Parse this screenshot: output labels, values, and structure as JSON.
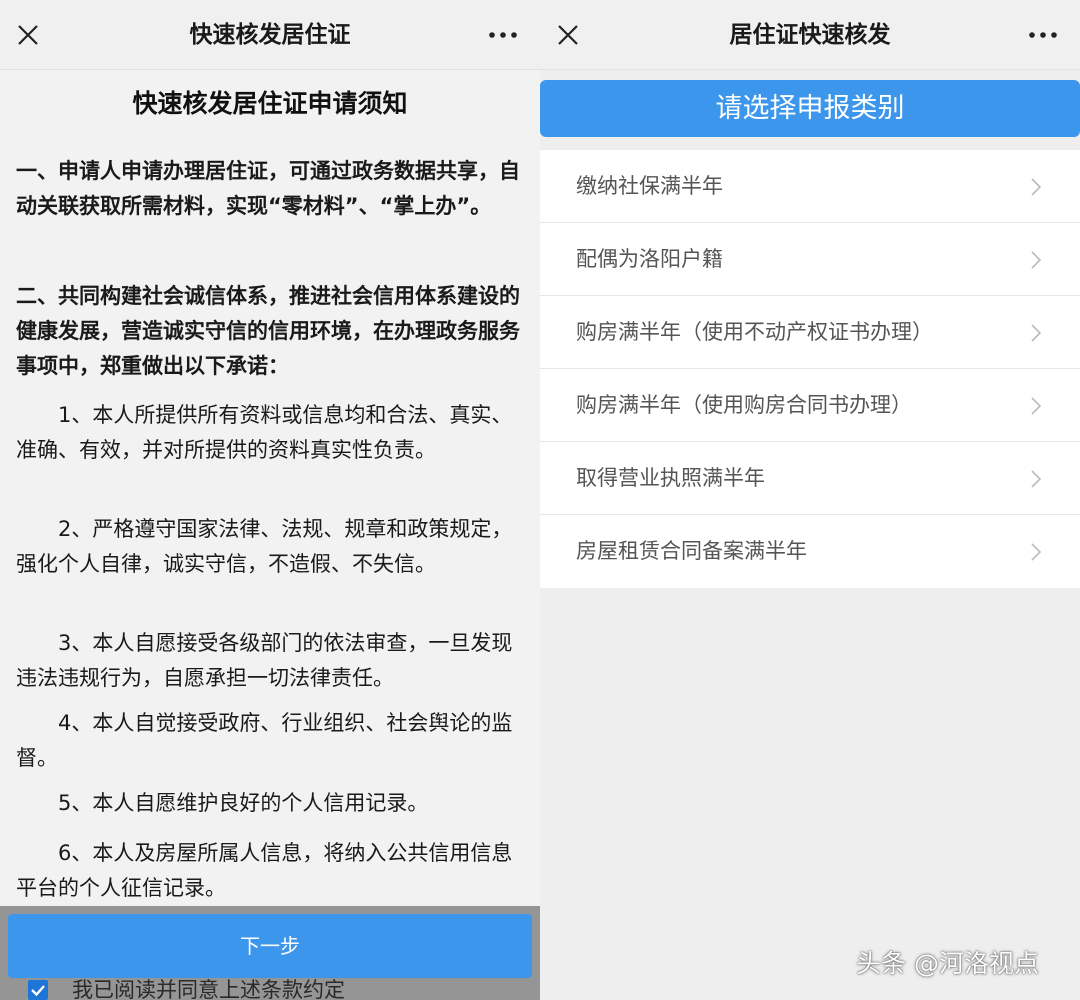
{
  "left": {
    "title": "快速核发居住证",
    "notice_title": "快速核发居住证申请须知",
    "paragraphs": [
      "一、申请人申请办理居住证，可通过政务数据共享，自动关联获取所需材料，实现“零材料”、“掌上办”。",
      "二、共同构建社会诚信体系，推进社会信用体系建设的健康发展，营造诚实守信的信用环境，在办理政务服务事项中，郑重做出以下承诺：",
      "1、本人所提供所有资料或信息均和合法、真实、准确、有效，并对所提供的资料真实性负责。",
      "2、严格遵守国家法律、法规、规章和政策规定，强化个人自律，诚实守信，不造假、不失信。",
      "3、本人自愿接受各级部门的依法审查，一旦发现违法违规行为，自愿承担一切法律责任。",
      "4、本人自觉接受政府、行业组织、社会舆论的监督。",
      "5、本人自愿维护良好的个人信用记录。",
      "6、本人及房屋所属人信息，将纳入公共信用信息平台的个人征信记录。"
    ],
    "next_button": "下一步",
    "agree_text": "我已阅读并同意上述条款约定",
    "agree_checked": true
  },
  "right": {
    "title": "居住证快速核发",
    "select_prompt": "请选择申报类别",
    "categories": [
      "缴纳社保满半年",
      "配偶为洛阳户籍",
      "购房满半年（使用不动产权证书办理）",
      "购房满半年（使用购房合同书办理）",
      "取得营业执照满半年",
      "房屋租赁合同备案满半年"
    ]
  },
  "watermark": "头条 @河洛视点",
  "colors": {
    "accent": "#3c96ec",
    "checkbox": "#1d75d8"
  }
}
